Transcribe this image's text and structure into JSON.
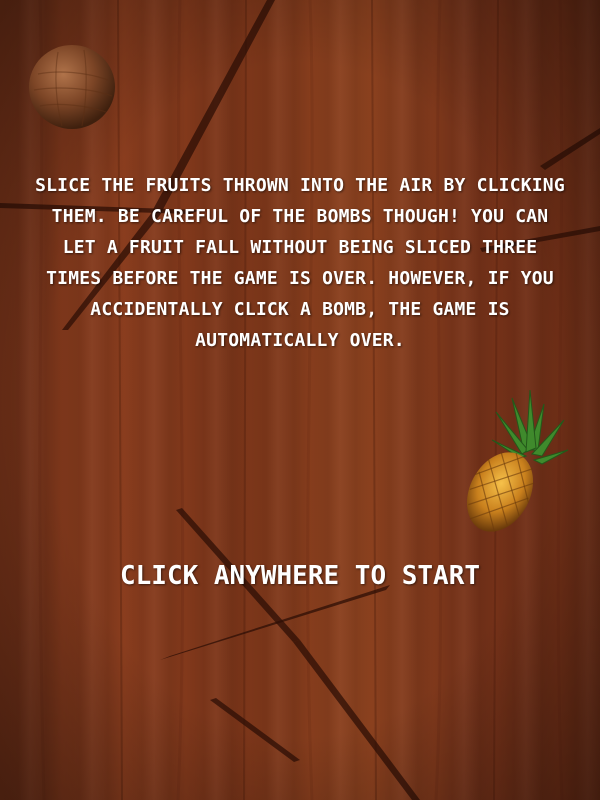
{
  "game": {
    "instructions": "Slice the fruits thrown into the air by clicking them. Be careful of the bombs though! You can let a fruit fall without being sliced three times before the game is over. However, if you accidentally click a bomb, the game is automatically over.",
    "start_prompt": "Click anywhere to start"
  },
  "sprites": {
    "coconut": "coconut-sprite",
    "pineapple": "pineapple-sprite"
  },
  "colors": {
    "wood_dark": "#6e2f17",
    "wood_light": "#8d421f",
    "text": "#ffffff"
  }
}
